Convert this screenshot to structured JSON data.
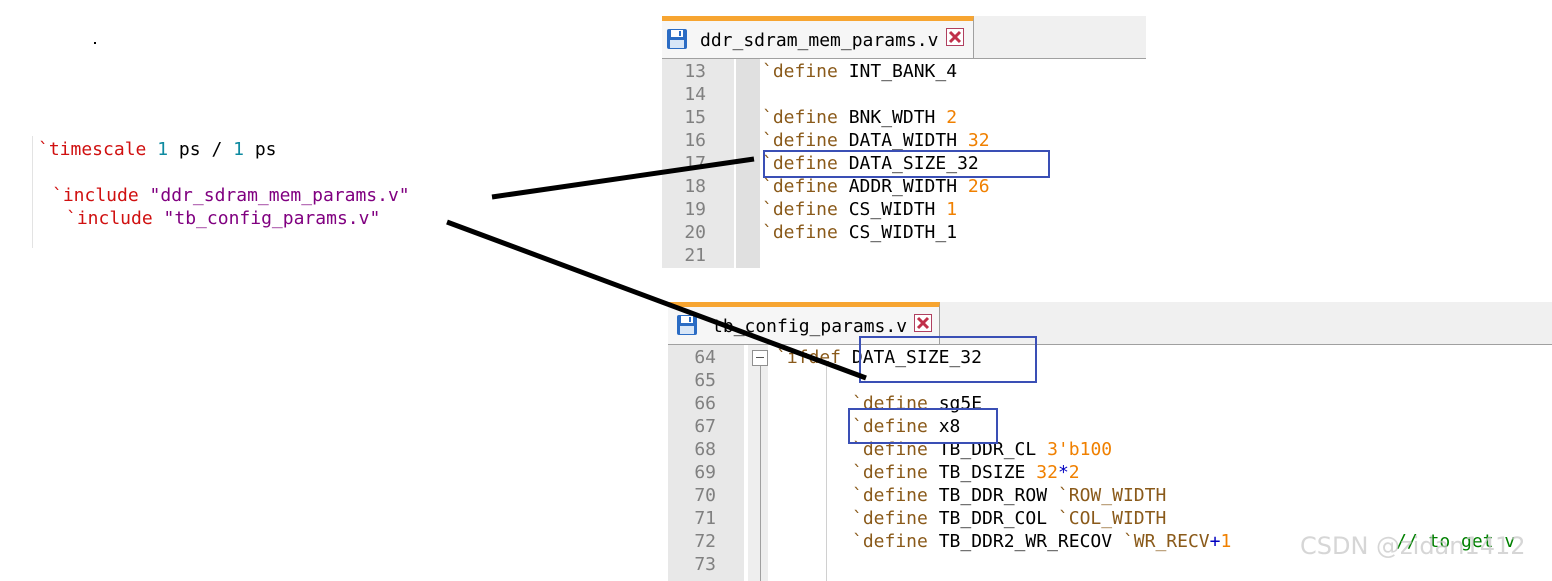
{
  "left_snippet": {
    "line1": {
      "kw": "`timescale",
      "n1": "1",
      "u1": "ps",
      "sep": "/",
      "n2": "1",
      "u2": "ps"
    },
    "line2": {
      "kw": "`include",
      "str": "\"ddr_sdram_mem_params.v\""
    },
    "line3": {
      "kw": "`include",
      "str": "\"tb_config_params.v\""
    }
  },
  "editor_top": {
    "tab_label": "ddr_sdram_mem_params.v",
    "lines": [
      {
        "num": "13",
        "kw": "`define",
        "name": "INT_BANK_4",
        "val": ""
      },
      {
        "num": "14",
        "kw": "",
        "name": "",
        "val": ""
      },
      {
        "num": "15",
        "kw": "`define",
        "name": "BNK_WDTH",
        "val": "2"
      },
      {
        "num": "16",
        "kw": "`define",
        "name": "DATA_WIDTH",
        "val": "32"
      },
      {
        "num": "17",
        "kw": "`define",
        "name": "DATA_SIZE_32",
        "val": ""
      },
      {
        "num": "18",
        "kw": "`define",
        "name": "ADDR_WIDTH",
        "val": "26"
      },
      {
        "num": "19",
        "kw": "`define",
        "name": "CS_WIDTH",
        "val": "1"
      },
      {
        "num": "20",
        "kw": "`define",
        "name": "CS_WIDTH_1",
        "val": ""
      },
      {
        "num": "21",
        "kw": "",
        "name": "",
        "val": ""
      }
    ]
  },
  "editor_bottom": {
    "tab_label": "tb_config_params.v",
    "line64": {
      "num": "64",
      "kw": "`ifdef",
      "name": "DATA_SIZE_32"
    },
    "line65": {
      "num": "65"
    },
    "line66": {
      "num": "66",
      "kw": "`define",
      "name": "sg5E"
    },
    "line67": {
      "num": "67",
      "kw": "`define",
      "name": "x8"
    },
    "line68": {
      "num": "68",
      "kw": "`define",
      "name": "TB_DDR_CL",
      "val": "3'b100"
    },
    "line69": {
      "num": "69",
      "kw": "`define",
      "name": "TB_DSIZE",
      "val": "32",
      "op": "*",
      "val2": "2"
    },
    "line70": {
      "num": "70",
      "kw": "`define",
      "name": "TB_DDR_ROW",
      "ref": "`ROW_WIDTH"
    },
    "line71": {
      "num": "71",
      "kw": "`define",
      "name": "TB_DDR_COL",
      "ref": "`COL_WIDTH"
    },
    "line72": {
      "num": "72",
      "kw": "`define",
      "name": "TB_DDR2_WR_RECOV",
      "ref": "`WR_RECV",
      "op": "+",
      "val": "1",
      "comment": "// to get v"
    },
    "line73": {
      "num": "73"
    }
  },
  "watermark": "CSDN @zidan1412",
  "colors": {
    "tab_accent": "#f7a531",
    "highlight_box": "#3a4fb5",
    "keyword_red": "#d01010",
    "string_purple": "#800080",
    "define_brown": "#8a5a1a",
    "number_orange": "#f08000"
  }
}
